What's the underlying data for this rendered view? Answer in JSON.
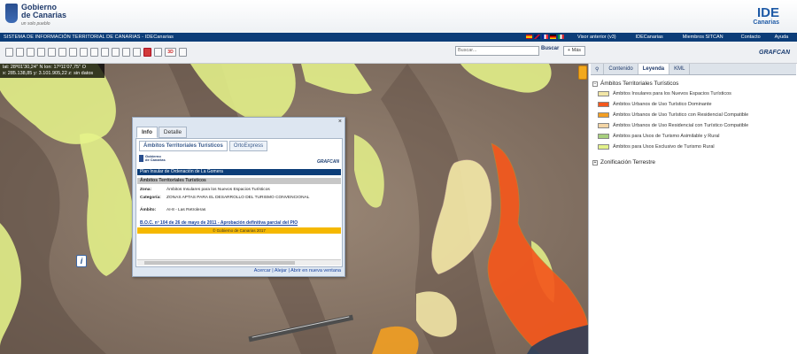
{
  "header": {
    "logo_line1": "Gobierno",
    "logo_line2": "de Canarias",
    "logo_tagline": "un solo pueblo",
    "ide_main": "IDE",
    "ide_sub": "Canarias"
  },
  "navbar": {
    "system_title": "SISTEMA DE INFORMACIÓN TERRITORIAL DE CANARIAS - IDECanarias",
    "links": [
      "Visor anterior (v3)",
      "IDECanarias",
      "Miembros SITCAN",
      "Contacto",
      "Ayuda"
    ]
  },
  "toolbar": {
    "search_placeholder": "Buscar...",
    "search_button": "Buscar",
    "more_button": "+ Más",
    "brand": "GRAFCAN"
  },
  "map": {
    "coords_line1": "lat: 28º01'30,24'' N lon: 17º11'07,75'' O",
    "coords_line2": "x: 285.138,85 y: 3.101.905,22 z: sin datos"
  },
  "popup": {
    "tabs": [
      "Info",
      "Detalle"
    ],
    "subtabs": [
      "Ámbitos Territoriales Turísticos",
      "OrtoExpress"
    ],
    "logo_line1": "Gobierno",
    "logo_line2": "de Canarias",
    "brand": "GRAFCAN",
    "plan_title": "Plan Insular de Ordenación de La Gomera",
    "section_title": "Ámbitos Territoriales Turísticos",
    "zona_label": "Zona:",
    "zona_value": "Ámbitos Insulares para los Nuevos Espacios Turísticos",
    "categoria_label": "Categoría:",
    "categoria_value": "ZONAS APTAS PARA EL DESARROLLO DEL TURISMO CONVENCIONAL",
    "ambito_label": "Ámbito:",
    "ambito_value": "AI-8 - Las Retroleras",
    "boc_link": "B.O.C. nº 104 de 26 de mayo de 2011 - Aprobación definitiva parcial del PIO",
    "copyright": "© Gobierno de Canarias 2017",
    "footer_links": "Acercar | Alejar | Abrir en nueva ventana"
  },
  "panel": {
    "tabs": [
      "Contenido",
      "Leyenda",
      "KML"
    ],
    "group1_title": "Ámbitos Territoriales Turísticos",
    "group2_title": "Zonificación Terrestre",
    "legend": [
      {
        "label": "Ámbitos Insulares para los Nuevos Espacios Turísticos",
        "color": "#f2e6a6"
      },
      {
        "label": "Ámbitos Urbanos de Uso Turístico Dominante",
        "color": "#f4571c"
      },
      {
        "label": "Ámbitos Urbanos de Uso Turístico con Residencial Compatible",
        "color": "#f29e22"
      },
      {
        "label": "Ámbitos Urbanos de Uso Residencial con Turístico Compatible",
        "color": "#f3d5a5"
      },
      {
        "label": "Ámbitos para Usos de Turismo Asimilable y Rural",
        "color": "#a7cf7e"
      },
      {
        "label": "Ámbitos para Usos Exclusivo de Turismo Rural",
        "color": "#e3f28a"
      }
    ]
  },
  "colors": {
    "navy": "#0c3d78",
    "accent_orange": "#f4571c"
  }
}
